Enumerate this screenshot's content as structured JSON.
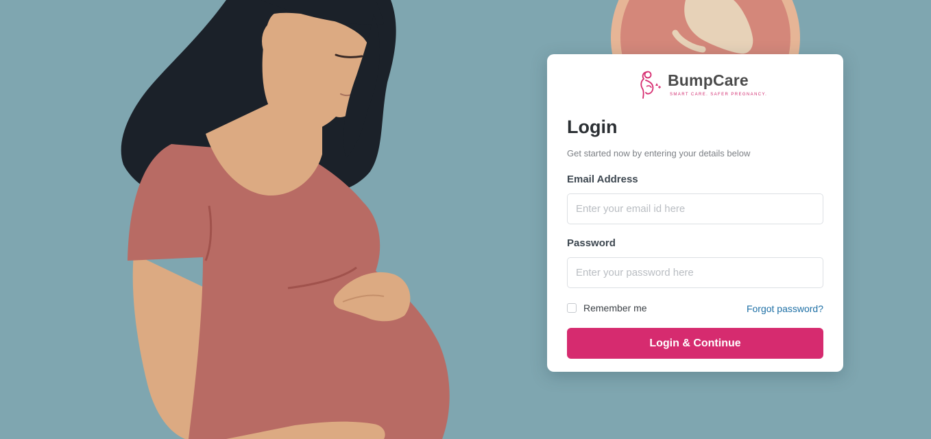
{
  "brand": {
    "name": "BumpCare",
    "tagline": "SMART CARE. SAFER PREGNANCY.",
    "accent_color": "#d62b6f"
  },
  "login": {
    "title": "Login",
    "subtitle": "Get started now by entering your details below",
    "email": {
      "label": "Email Address",
      "placeholder": "Enter your email id here",
      "value": ""
    },
    "password": {
      "label": "Password",
      "placeholder": "Enter your password here",
      "value": ""
    },
    "remember_label": "Remember me",
    "remember_checked": false,
    "forgot_label": "Forgot password?",
    "submit_label": "Login & Continue"
  },
  "colors": {
    "background": "#7fa6b0",
    "link": "#1d6fa5"
  },
  "icons": {
    "brand_mark": "pregnant-mother-logo-icon",
    "checkbox": "checkbox-unchecked-icon"
  }
}
